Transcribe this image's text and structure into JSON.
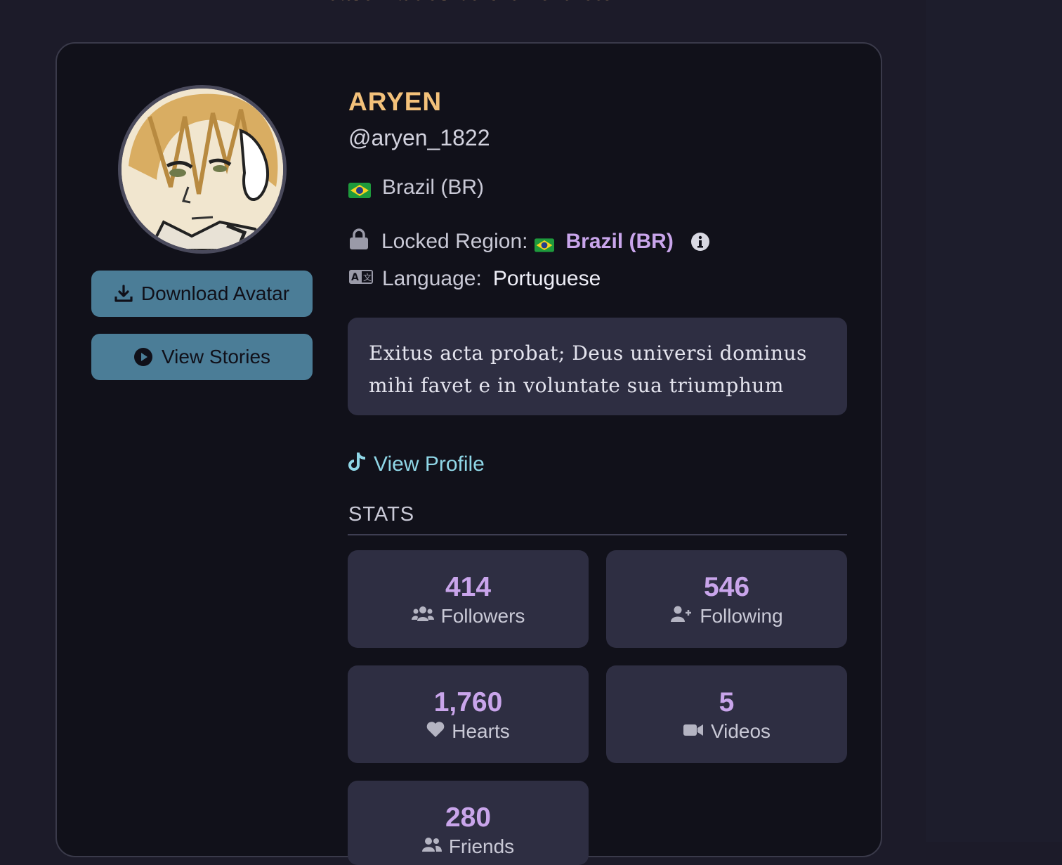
{
  "header": {
    "notice": "Please wait 6s before next fetch."
  },
  "profile": {
    "display_name": "ARYEN",
    "username": "@aryen_1822",
    "country": "Brazil (BR)",
    "locked_region_label": "Locked Region:",
    "locked_region_value": "Brazil (BR)",
    "language_label": "Language:",
    "language_value": "Portuguese",
    "bio": "Exitus acta probat; Deus universi dominus mihi favet e in voluntate sua triumphum"
  },
  "actions": {
    "download_avatar": "Download Avatar",
    "view_stories": "View Stories",
    "view_profile": "View Profile"
  },
  "stats": {
    "title": "STATS",
    "items": [
      {
        "value": "414",
        "label": "Followers",
        "icon": "users-icon"
      },
      {
        "value": "546",
        "label": "Following",
        "icon": "user-plus-icon"
      },
      {
        "value": "1,760",
        "label": "Hearts",
        "icon": "heart-icon"
      },
      {
        "value": "5",
        "label": "Videos",
        "icon": "video-icon"
      },
      {
        "value": "280",
        "label": "Friends",
        "icon": "friends-icon"
      }
    ]
  },
  "colors": {
    "accent_name": "#f3c17a",
    "accent_stat": "#c9a5eb",
    "link": "#8fd6e6",
    "button": "#4b7d97"
  }
}
